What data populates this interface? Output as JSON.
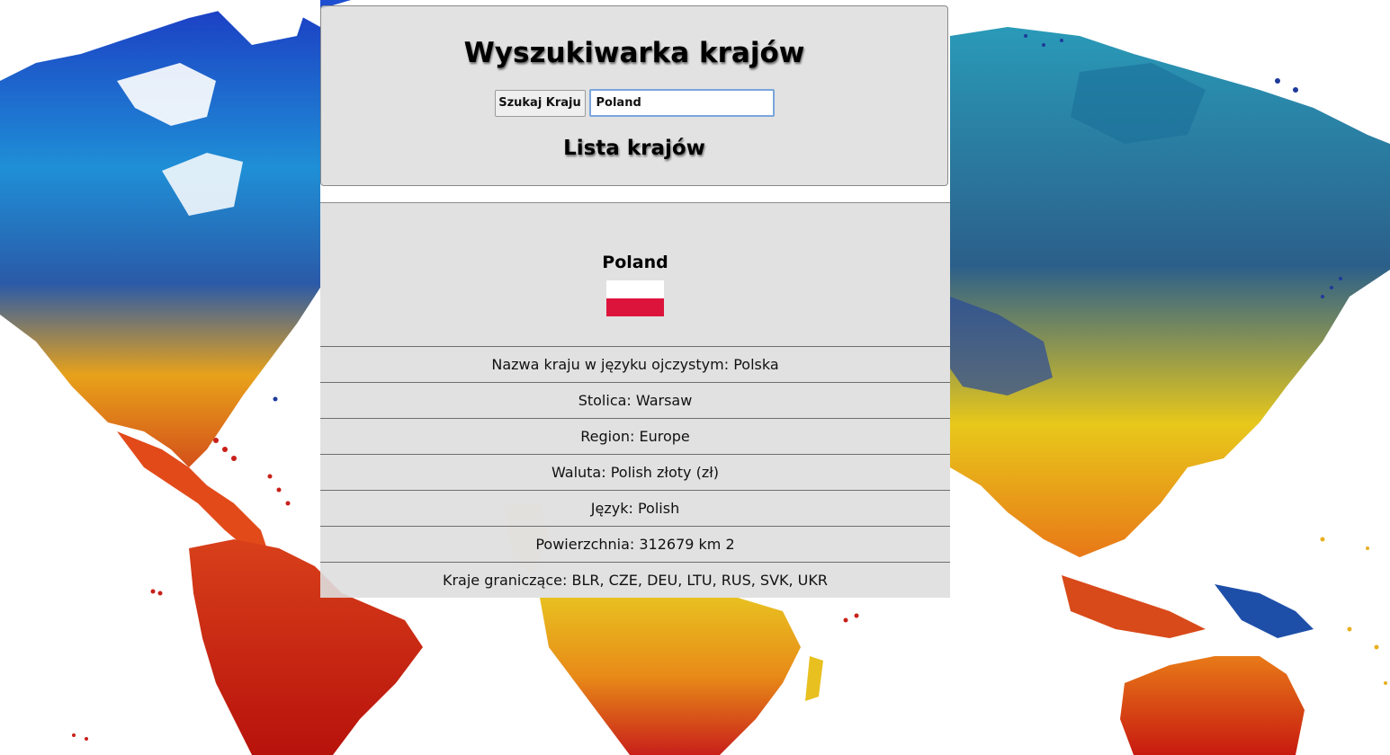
{
  "header": {
    "title": "Wyszukiwarka krajów",
    "search_button_label": "Szukaj Kraju",
    "search_value": "Poland",
    "list_heading": "Lista krajów"
  },
  "result": {
    "name": "Poland",
    "flag_colors": [
      "#ffffff",
      "#dc143c"
    ],
    "details": [
      "Nazwa kraju w języku ojczystym: Polska",
      "Stolica: Warsaw",
      "Region: Europe",
      "Waluta: Polish złoty (zł)",
      "Język: Polish",
      "Powierzchnia: 312679 km 2",
      "Kraje graniczące: BLR, CZE, DEU, LTU, RUS, SVK, UKR"
    ]
  },
  "background": {
    "icon": "world-map-watercolor",
    "colors": [
      "#1e4fd0",
      "#22a8d8",
      "#f2b705",
      "#e2601a",
      "#c8140e",
      "#2f8a6a"
    ]
  }
}
